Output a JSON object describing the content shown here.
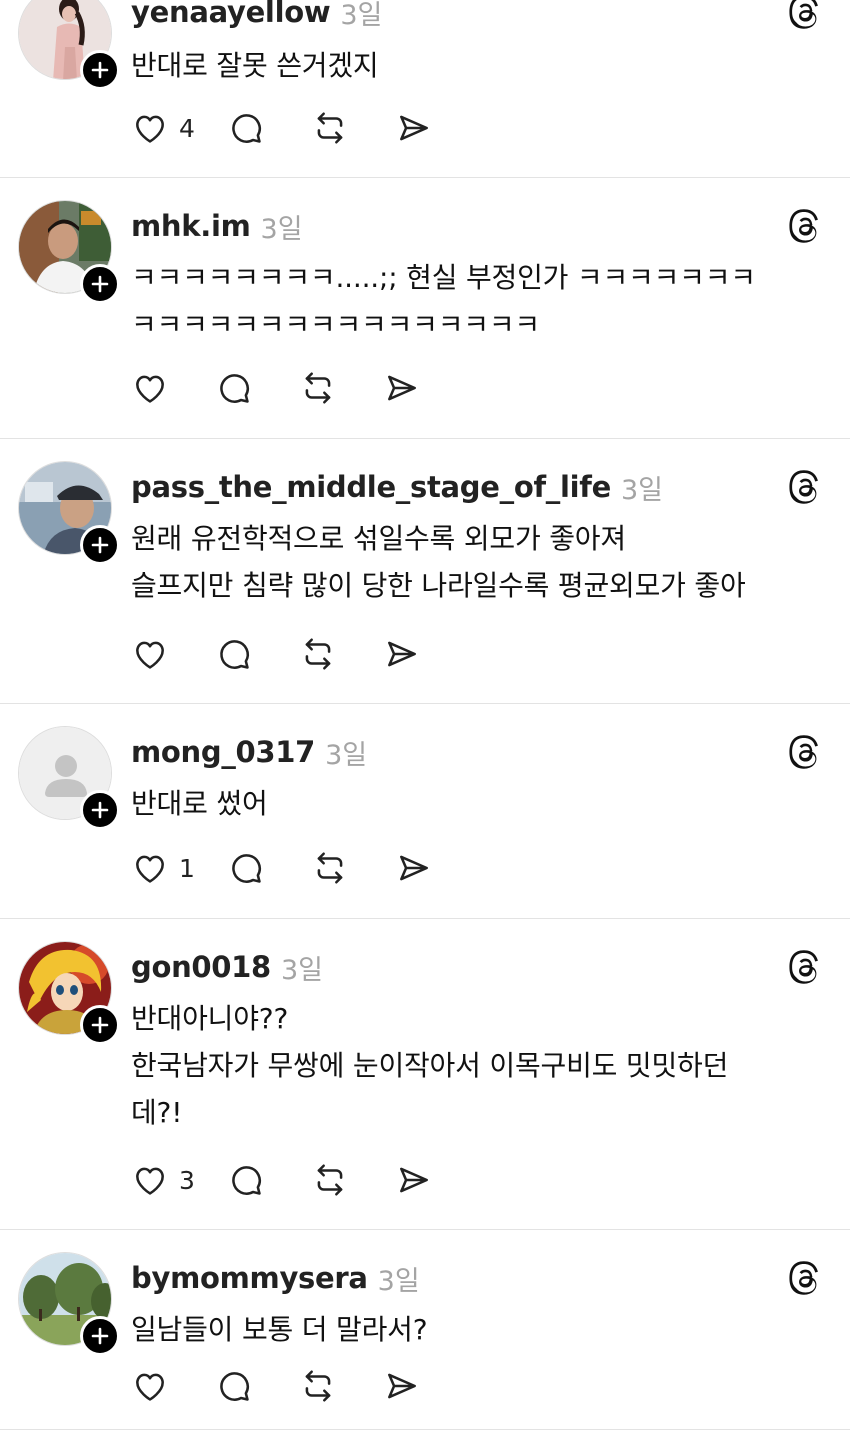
{
  "posts": [
    {
      "username": "yenaayellow",
      "time": "3일",
      "lines": [
        "반대로 잘못 쓴거겠지"
      ],
      "likes": "4",
      "avatar": "woman-portrait"
    },
    {
      "username": "mhk.im",
      "time": "3일",
      "lines": [
        "ㅋㅋㅋㅋㅋㅋㅋㅋ.....;; 현실 부정인가 ㅋㅋㅋㅋㅋㅋㅋ",
        "ㅋㅋㅋㅋㅋㅋㅋㅋㅋㅋㅋㅋㅋㅋㅋㅋ"
      ],
      "likes": "",
      "avatar": "man-portrait"
    },
    {
      "username": "pass_the_middle_stage_of_life",
      "time": "3일",
      "lines": [
        "원래 유전학적으로 섞일수록 외모가 좋아져",
        "슬프지만 침략 많이 당한 나라일수록 평균외모가 좋아"
      ],
      "likes": "",
      "avatar": "man-with-cap"
    },
    {
      "username": "mong_0317",
      "time": "3일",
      "lines": [
        "반대로 썼어"
      ],
      "likes": "1",
      "avatar": "default-person"
    },
    {
      "username": "gon0018",
      "time": "3일",
      "lines": [
        "반대아니야??",
        "한국남자가 무쌍에 눈이작아서 이목구비도 밋밋하던",
        "데?!"
      ],
      "likes": "3",
      "avatar": "anime-character"
    },
    {
      "username": "bymommysera",
      "time": "3일",
      "lines": [
        "일남들이 보통 더 말라서?"
      ],
      "likes": "",
      "avatar": "park-trees"
    }
  ],
  "icons": {
    "like": "heart-icon",
    "reply": "comment-bubble-icon",
    "repost": "repost-icon",
    "share": "send-icon",
    "brand": "threads-logo-icon",
    "follow": "plus-icon"
  }
}
